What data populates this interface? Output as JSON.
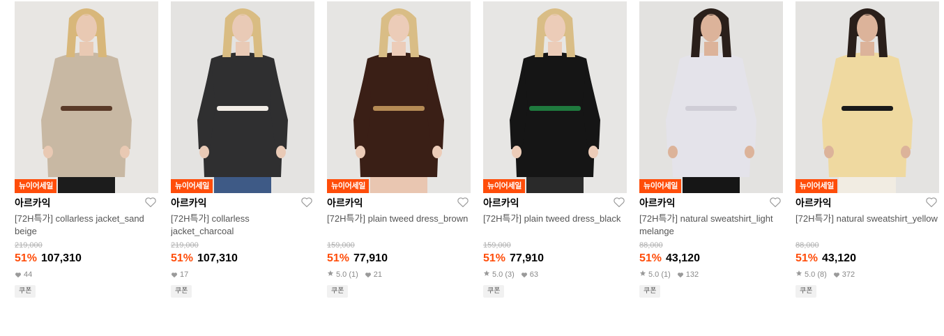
{
  "colors": {
    "accent": "#ff4d0a",
    "tag_bg": "#ff4d0a",
    "muted_text": "#888888"
  },
  "products": [
    {
      "tag": "뉴이어세일",
      "brand": "아르카익",
      "name": "[72H특가] collarless jacket_sand beige",
      "original_price": "219,000",
      "discount": "51%",
      "price": "107,310",
      "rating": "",
      "likes": "44",
      "coupon": "쿠폰",
      "image": {
        "bg": "#e8e6e3",
        "garment": "#c8b8a3",
        "skin": "#e9c9b3",
        "hair": "#d8b77a",
        "bottom": "#1c1c1c",
        "accent": "#5a3a28"
      }
    },
    {
      "tag": "뉴이어세일",
      "brand": "아르카익",
      "name": "[72H특가] collarless jacket_charcoal",
      "original_price": "219,000",
      "discount": "51%",
      "price": "107,310",
      "rating": "",
      "likes": "17",
      "coupon": "쿠폰",
      "image": {
        "bg": "#e4e3e1",
        "garment": "#2f2f30",
        "skin": "#e9cab6",
        "hair": "#d9bc82",
        "bottom": "#3e5a86",
        "accent": "#f2ede6"
      }
    },
    {
      "tag": "뉴이어세일",
      "brand": "아르카익",
      "name": "[72H특가] plain tweed dress_brown",
      "original_price": "159,000",
      "discount": "51%",
      "price": "77,910",
      "rating": "5.0 (1)",
      "likes": "21",
      "coupon": "쿠폰",
      "image": {
        "bg": "#e6e5e3",
        "garment": "#3a1f16",
        "skin": "#ecccb8",
        "hair": "#d9bd86",
        "bottom": "#e9c6b1",
        "accent": "#b58b55"
      }
    },
    {
      "tag": "뉴이어세일",
      "brand": "아르카익",
      "name": "[72H특가] plain tweed dress_black",
      "original_price": "159,000",
      "discount": "51%",
      "price": "77,910",
      "rating": "5.0 (3)",
      "likes": "63",
      "coupon": "쿠폰",
      "image": {
        "bg": "#e7e6e4",
        "garment": "#151515",
        "skin": "#ecccb8",
        "hair": "#d9bd86",
        "bottom": "#2a2a2a",
        "accent": "#1f7a3e"
      }
    },
    {
      "tag": "뉴이어세일",
      "brand": "아르카익",
      "name": "[72H특가] natural sweatshirt_light melange",
      "original_price": "88,000",
      "discount": "51%",
      "price": "43,120",
      "rating": "5.0 (1)",
      "likes": "132",
      "coupon": "쿠폰",
      "image": {
        "bg": "#e3e2e0",
        "garment": "#e4e3ea",
        "skin": "#dcb39a",
        "hair": "#2a1f1a",
        "bottom": "#161616",
        "accent": "#cfcdd6"
      }
    },
    {
      "tag": "뉴이어세일",
      "brand": "아르카익",
      "name": "[72H특가] natural sweatshirt_yellow",
      "original_price": "88,000",
      "discount": "51%",
      "price": "43,120",
      "rating": "5.0 (8)",
      "likes": "372",
      "coupon": "쿠폰",
      "image": {
        "bg": "#e4e3e1",
        "garment": "#efd9a0",
        "skin": "#dcb39a",
        "hair": "#2a1f1a",
        "bottom": "#f1ece2",
        "accent": "#1a1a1a"
      }
    }
  ]
}
